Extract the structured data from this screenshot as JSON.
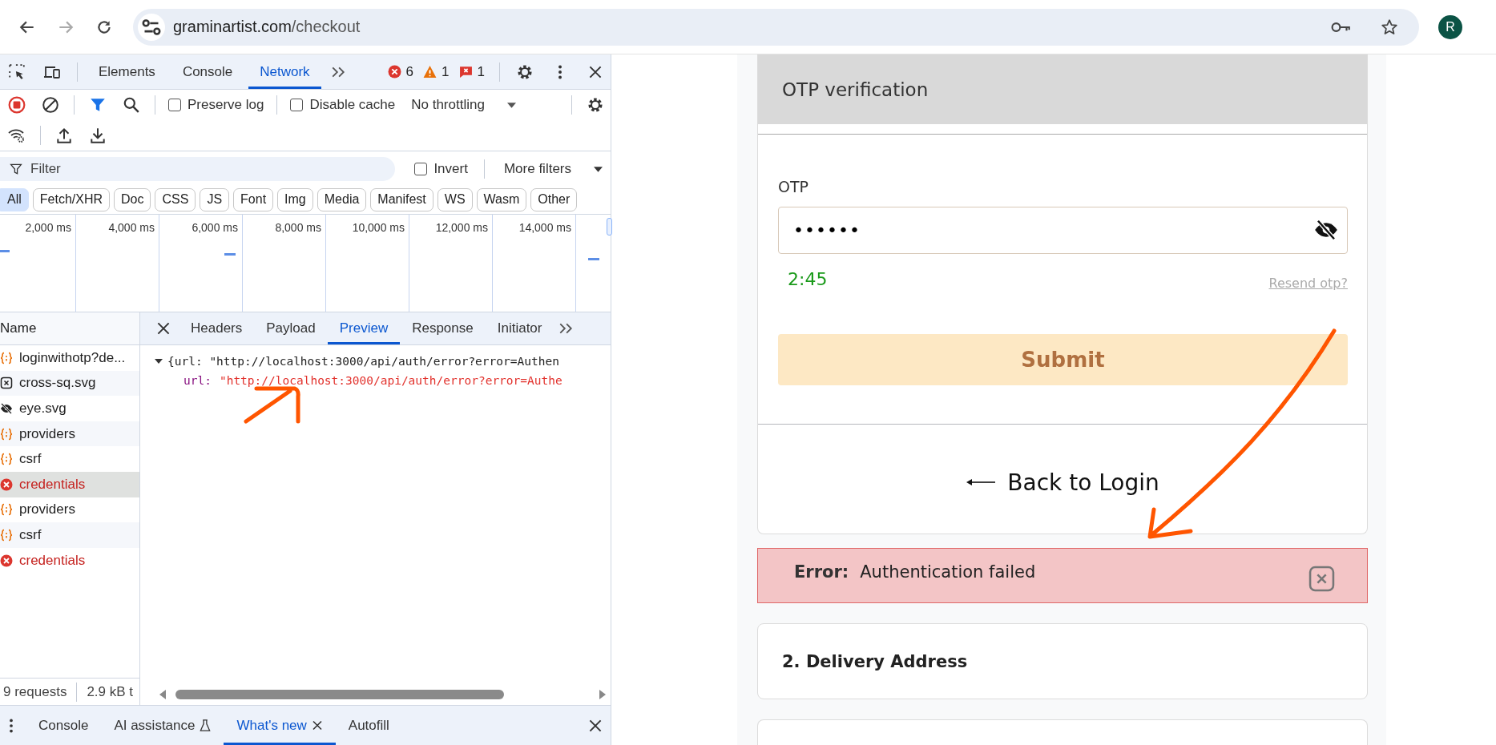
{
  "browser": {
    "url_host": "graminartist.com",
    "url_path": "/checkout",
    "profile_initial": "R"
  },
  "devtools": {
    "tabs": [
      {
        "label": "Elements",
        "selected": false
      },
      {
        "label": "Console",
        "selected": false
      },
      {
        "label": "Network",
        "selected": true
      }
    ],
    "counts": {
      "errors": "6",
      "warnings": "1",
      "issues": "1"
    },
    "preserve_log": {
      "label": "Preserve log",
      "checked": false
    },
    "disable_cache": {
      "label": "Disable cache",
      "checked": false
    },
    "throttling": "No throttling",
    "filter": {
      "placeholder": "Filter"
    },
    "invert": {
      "label": "Invert",
      "checked": false
    },
    "more_filters": "More filters",
    "type_filters": [
      {
        "label": "All",
        "selected": true
      },
      {
        "label": "Fetch/XHR",
        "selected": false
      },
      {
        "label": "Doc",
        "selected": false
      },
      {
        "label": "CSS",
        "selected": false
      },
      {
        "label": "JS",
        "selected": false
      },
      {
        "label": "Font",
        "selected": false
      },
      {
        "label": "Img",
        "selected": false
      },
      {
        "label": "Media",
        "selected": false
      },
      {
        "label": "Manifest",
        "selected": false
      },
      {
        "label": "WS",
        "selected": false
      },
      {
        "label": "Wasm",
        "selected": false
      },
      {
        "label": "Other",
        "selected": false
      }
    ],
    "timeline_ticks": [
      "2,000 ms",
      "4,000 ms",
      "6,000 ms",
      "8,000 ms",
      "10,000 ms",
      "12,000 ms",
      "14,000 ms"
    ],
    "requests": {
      "header": "Name",
      "items": [
        {
          "name": "loginwithotp?de...",
          "kind": "fetch",
          "selected": false
        },
        {
          "name": "cross-sq.svg",
          "kind": "svg-cross",
          "selected": false
        },
        {
          "name": "eye.svg",
          "kind": "svg-eye",
          "selected": false
        },
        {
          "name": "providers",
          "kind": "fetch",
          "selected": false
        },
        {
          "name": "csrf",
          "kind": "fetch",
          "selected": false
        },
        {
          "name": "credentials",
          "kind": "error",
          "selected": true
        },
        {
          "name": "providers",
          "kind": "fetch",
          "selected": false
        },
        {
          "name": "csrf",
          "kind": "fetch",
          "selected": false
        },
        {
          "name": "credentials",
          "kind": "error",
          "selected": false
        }
      ]
    },
    "detail_tabs": [
      {
        "label": "Headers",
        "selected": false
      },
      {
        "label": "Payload",
        "selected": false
      },
      {
        "label": "Preview",
        "selected": true
      },
      {
        "label": "Response",
        "selected": false
      },
      {
        "label": "Initiator",
        "selected": false
      }
    ],
    "preview": {
      "summary": "{url: \"http://localhost:3000/api/auth/error?error=Authen",
      "key": "url:",
      "value": "\"http://localhost:3000/api/auth/error?error=Authe"
    },
    "status": {
      "requests": "9 requests",
      "transferred": "2.9 kB t"
    },
    "drawer_tabs": [
      {
        "label": "Console",
        "selected": false,
        "kind": "plain"
      },
      {
        "label": "AI assistance",
        "selected": false,
        "kind": "lab"
      },
      {
        "label": "What's new",
        "selected": true,
        "kind": "closable"
      },
      {
        "label": "Autofill",
        "selected": false,
        "kind": "plain"
      }
    ]
  },
  "page": {
    "otp_card": {
      "title": "OTP verification",
      "label": "OTP",
      "value": "••••••",
      "timer": "2:45",
      "resend": "Resend otp?",
      "submit": "Submit",
      "back": "Back to Login"
    },
    "error": {
      "label": "Error:",
      "message": "Authentication failed"
    },
    "delivery": {
      "title": "2. Delivery Address"
    }
  }
}
